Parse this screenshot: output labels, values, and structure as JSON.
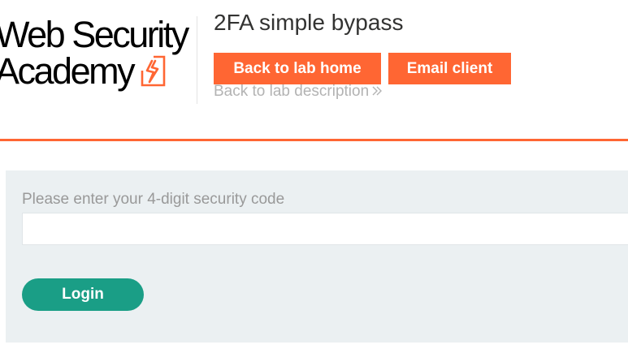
{
  "brand": {
    "logo_line1": "Web Security",
    "logo_line2": "Academy",
    "logo_icon": "lightning-bolt-icon",
    "accent_color": "#ff6633"
  },
  "header": {
    "lab_title": "2FA simple bypass",
    "back_to_lab_home_label": "Back to lab home",
    "email_client_label": "Email client",
    "back_to_lab_description_label": "Back to lab description",
    "description_link_icon": "double-chevron-right-icon"
  },
  "login_form": {
    "security_code_label": "Please enter your 4-digit security code",
    "security_code_value": "",
    "login_button_label": "Login",
    "login_button_color": "#1a9e86",
    "panel_color": "#ebf0f2"
  }
}
